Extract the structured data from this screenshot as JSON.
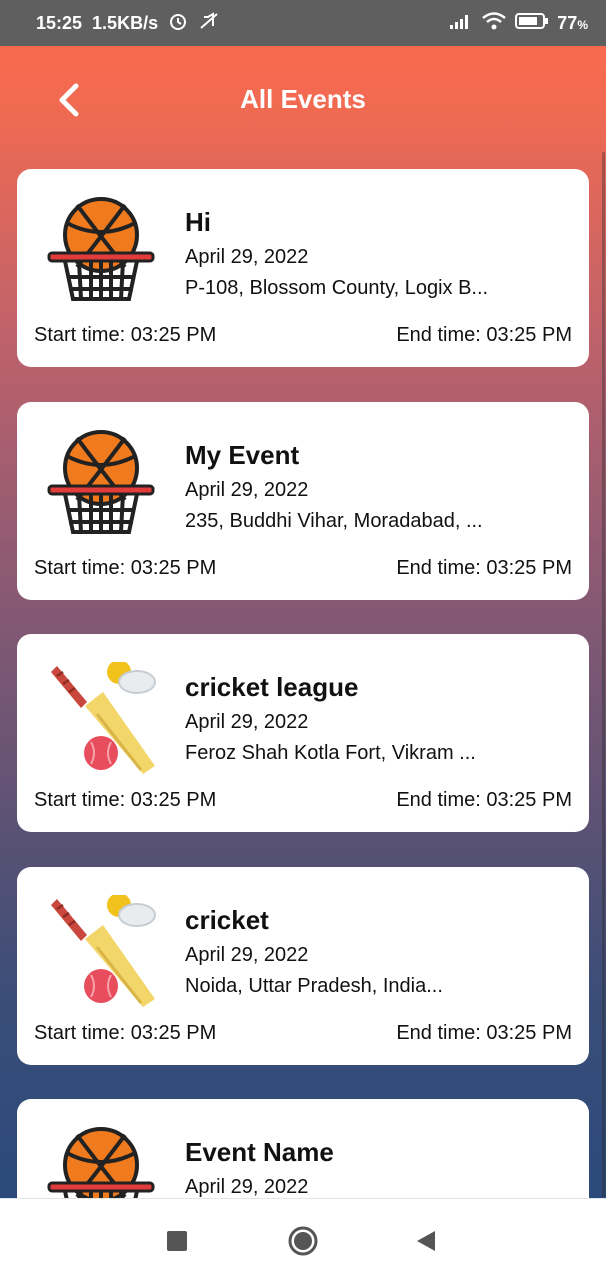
{
  "status_bar": {
    "time": "15:25",
    "speed": "1.5KB/s",
    "battery": "77",
    "battery_unit": "%"
  },
  "header": {
    "title": "All Events"
  },
  "events": [
    {
      "name": "Hi",
      "date": "April 29, 2022",
      "address": "P-108, Blossom County, Logix B...",
      "start": "Start time: 03:25 PM",
      "end": "End time: 03:25 PM",
      "icon": "basketball-icon"
    },
    {
      "name": "My Event",
      "date": "April 29, 2022",
      "address": "235, Buddhi Vihar, Moradabad, ...",
      "start": "Start time: 03:25 PM",
      "end": "End time: 03:25 PM",
      "icon": "basketball-icon"
    },
    {
      "name": "cricket league",
      "date": "April 29, 2022",
      "address": "Feroz Shah Kotla Fort, Vikram ...",
      "start": "Start time: 03:25 PM",
      "end": "End time: 03:25 PM",
      "icon": "cricket-icon"
    },
    {
      "name": "cricket",
      "date": "April 29, 2022",
      "address": "Noida, Uttar Pradesh, India...",
      "start": "Start time: 03:25 PM",
      "end": "End time: 03:25 PM",
      "icon": "cricket-icon"
    },
    {
      "name": "Event Name",
      "date": "April 29, 2022",
      "address": "",
      "start": "",
      "end": "",
      "icon": "basketball-icon"
    }
  ],
  "colors": {
    "header_top": "#ff6b4e",
    "background_bottom": "#2b4a7c",
    "card": "#ffffff"
  }
}
